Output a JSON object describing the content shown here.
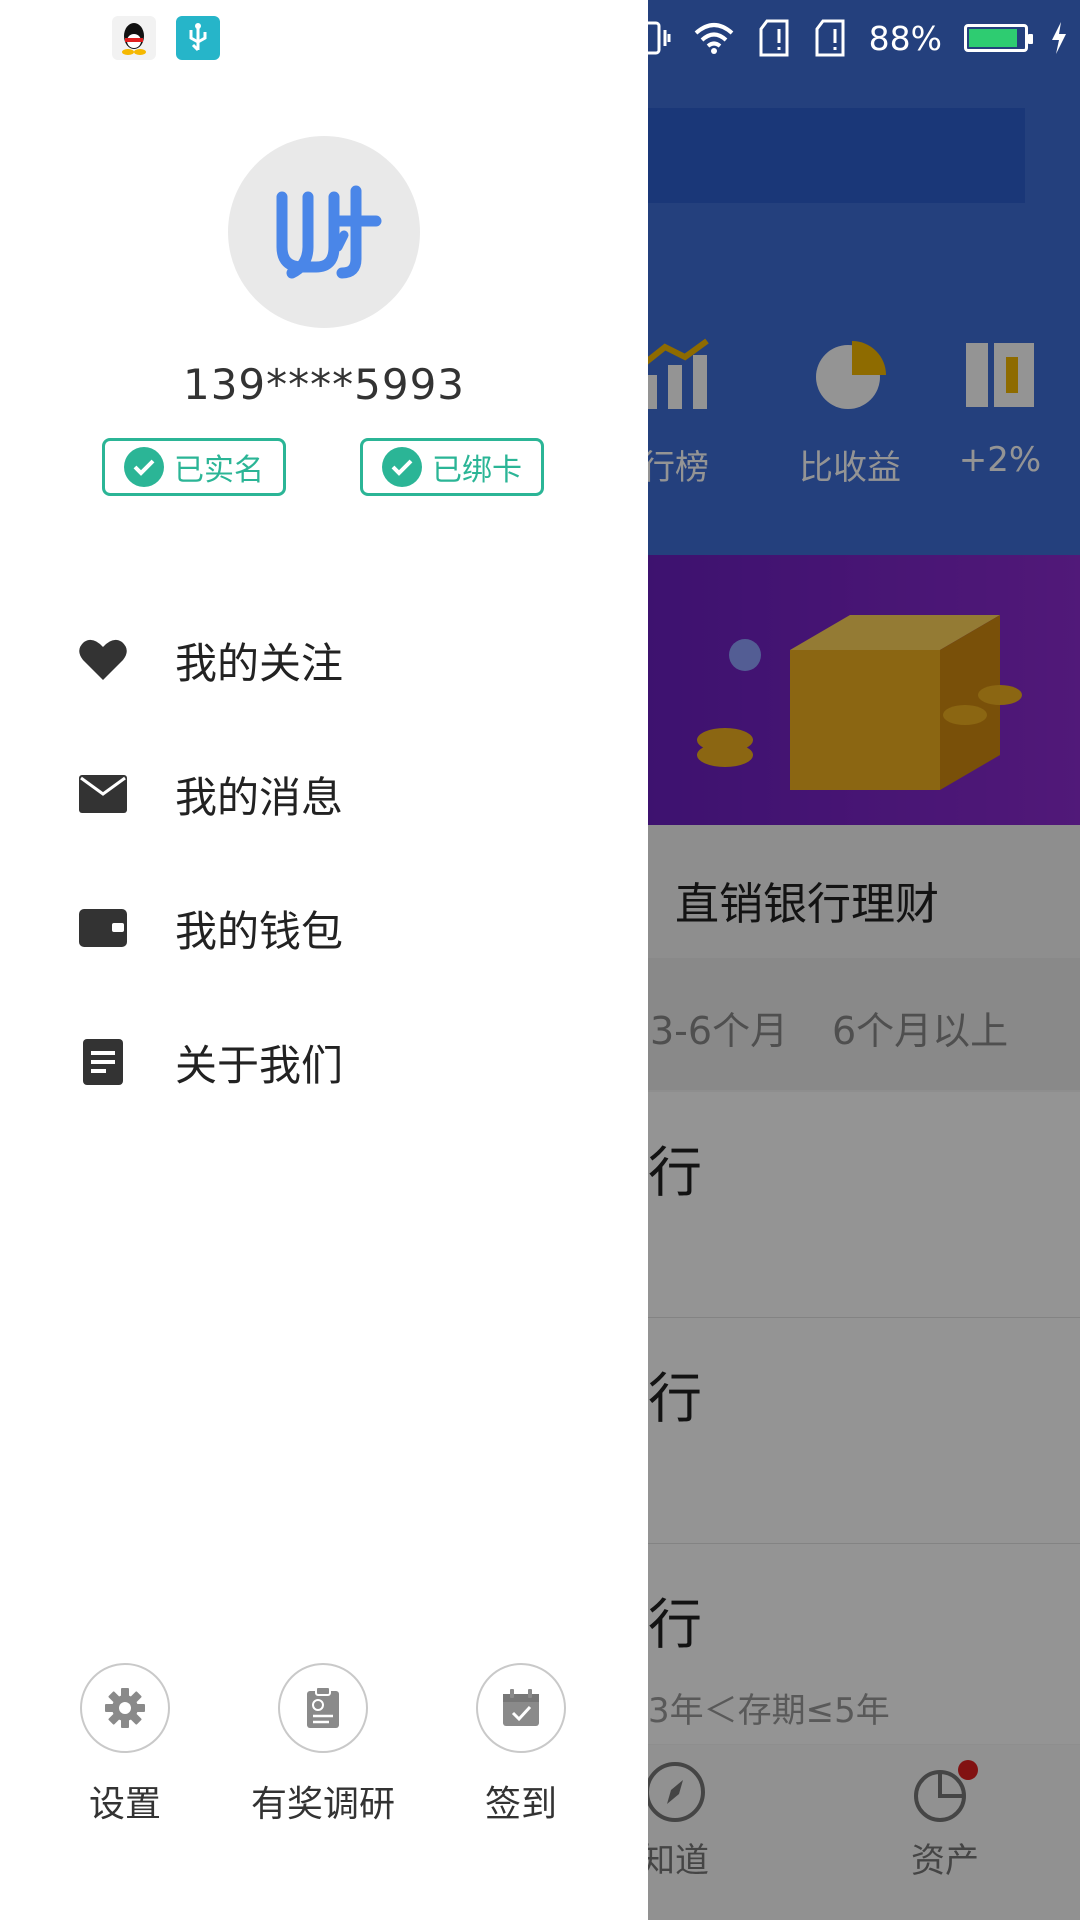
{
  "status_bar": {
    "battery_text": "88%",
    "battery_level": 0.88,
    "left_icons": [
      "qq-icon",
      "usb-icon"
    ],
    "right_icons": [
      "vibrate-icon",
      "wifi-icon",
      "sim1-icon",
      "sim2-icon",
      "battery-icon",
      "charging-icon"
    ]
  },
  "drawer": {
    "phone": "139****5993",
    "badges": [
      {
        "label": "已实名"
      },
      {
        "label": "已绑卡"
      }
    ],
    "menu": [
      {
        "label": "我的关注",
        "icon": "heart-icon"
      },
      {
        "label": "我的消息",
        "icon": "mail-icon"
      },
      {
        "label": "我的钱包",
        "icon": "wallet-icon"
      },
      {
        "label": "关于我们",
        "icon": "document-icon"
      }
    ],
    "bottom_actions": [
      {
        "label": "设置",
        "icon": "gear-icon"
      },
      {
        "label": "有奖调研",
        "icon": "clipboard-icon"
      },
      {
        "label": "签到",
        "icon": "calendar-check-icon"
      }
    ],
    "accent_color": "#2bb596",
    "avatar_color": "#4a86e8"
  },
  "background": {
    "categories": [
      {
        "label": "行榜"
      },
      {
        "label": "比收益"
      },
      {
        "label": "+2%"
      }
    ],
    "section_title": "直销银行理财",
    "filters": [
      "3-6个月",
      "6个月以上"
    ],
    "rows": [
      "行",
      "行",
      "行"
    ],
    "term_text": "3年＜存期≤5年",
    "tabs": [
      {
        "label": "知道"
      },
      {
        "label": "资产"
      }
    ],
    "primary_color": "#3f6fd8"
  }
}
